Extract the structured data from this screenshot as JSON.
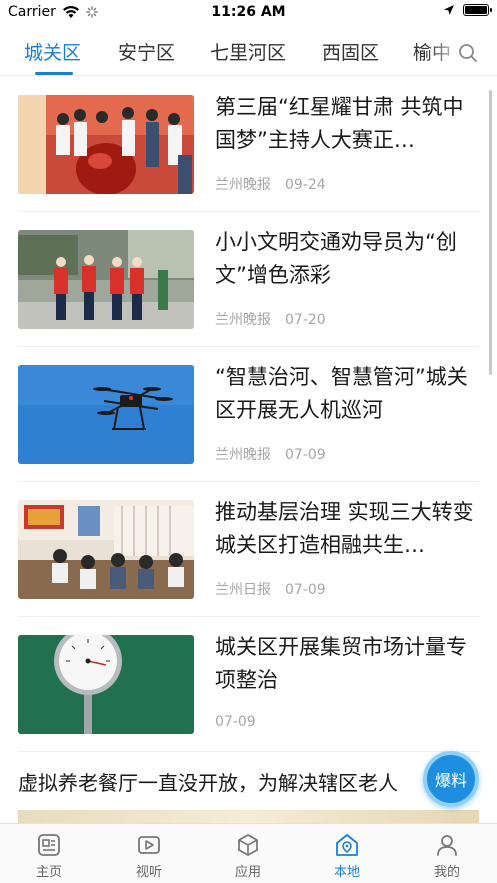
{
  "status_bar": {
    "carrier": "Carrier",
    "time": "11:26 AM"
  },
  "tabs": [
    {
      "label": "城关区",
      "active": true
    },
    {
      "label": "安宁区",
      "active": false
    },
    {
      "label": "七里河区",
      "active": false
    },
    {
      "label": "西固区",
      "active": false
    },
    {
      "label": "榆中",
      "active": false
    }
  ],
  "news": [
    {
      "title": "第三届“红星耀甘肃 共筑中国梦”主持人大赛正…",
      "source": "兰州晚报",
      "date": "09-24",
      "thumb_icon": "ceremony-photo"
    },
    {
      "title": "小小文明交通劝导员为“创文”增色添彩",
      "source": "兰州晚报",
      "date": "07-20",
      "thumb_icon": "volunteers-photo"
    },
    {
      "title": "“智慧治河、智慧管河”城关区开展无人机巡河",
      "source": "兰州晚报",
      "date": "07-09",
      "thumb_icon": "drone-photo"
    },
    {
      "title": "推动基层治理 实现三大转变 城关区打造相融共生…",
      "source": "兰州日报",
      "date": "07-09",
      "thumb_icon": "meeting-photo"
    },
    {
      "title": "城关区开展集贸市场计量专项整治",
      "source": "",
      "date": "07-09",
      "thumb_icon": "gauge-photo"
    }
  ],
  "wide_news_title": "虚拟养老餐厅一直没开放，为解决辖区老人",
  "tip_button": "爆料",
  "bottom_nav": [
    {
      "label": "主页",
      "icon": "news-icon",
      "active": false
    },
    {
      "label": "视听",
      "icon": "video-icon",
      "active": false
    },
    {
      "label": "应用",
      "icon": "cube-icon",
      "active": false
    },
    {
      "label": "本地",
      "icon": "location-home-icon",
      "active": true
    },
    {
      "label": "我的",
      "icon": "person-icon",
      "active": false
    }
  ],
  "colors": {
    "accent": "#1a7fd4",
    "meta_text": "#a6a6a6",
    "tip_button": "#1e8fe0"
  }
}
